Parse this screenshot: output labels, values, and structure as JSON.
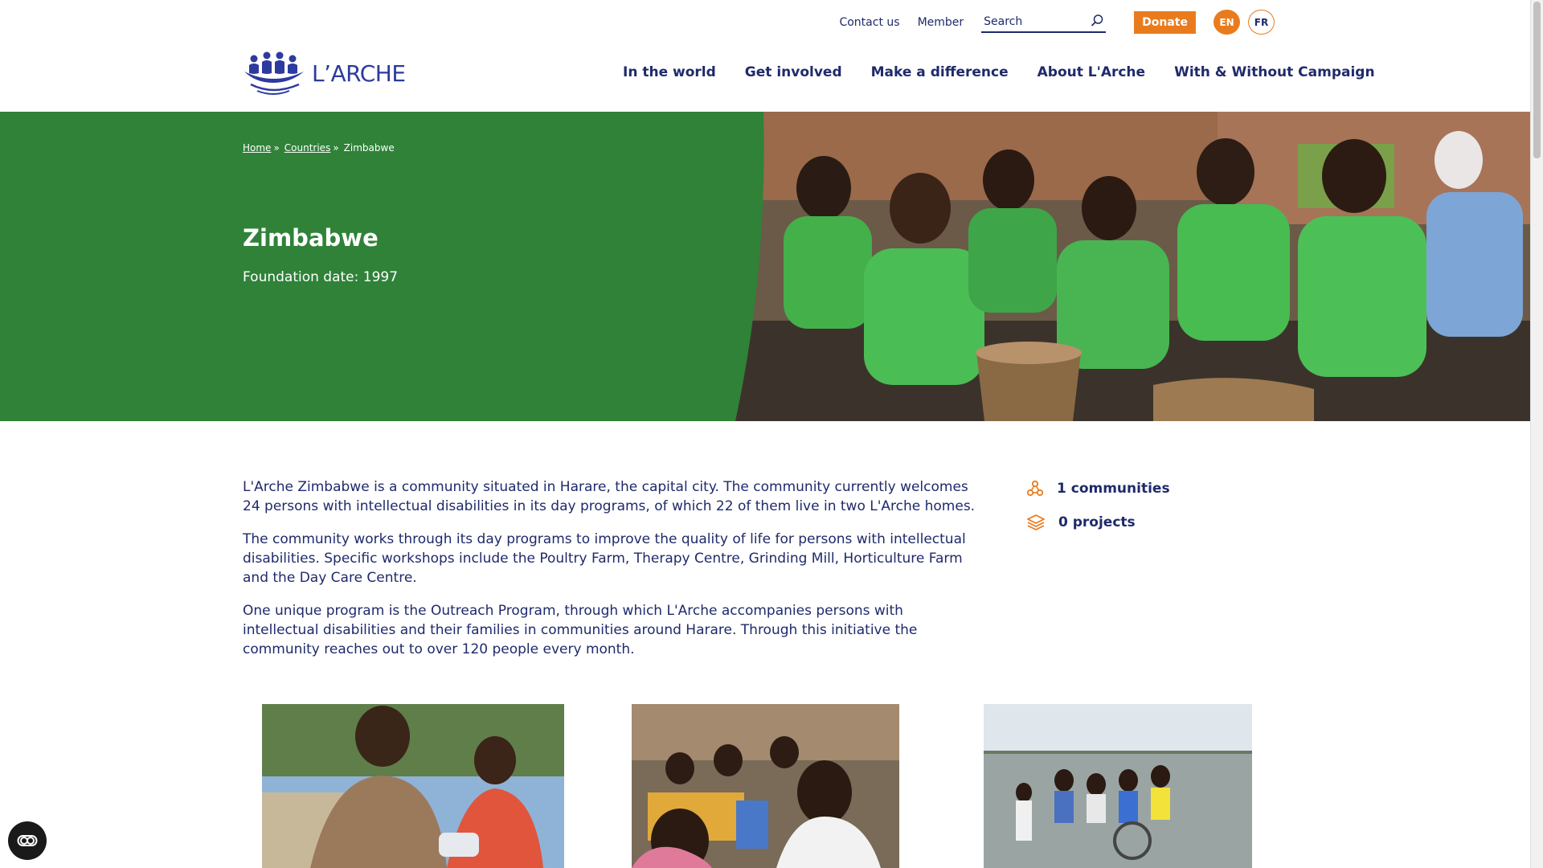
{
  "header": {
    "utility": {
      "contact": "Contact us",
      "member": "Member",
      "search_placeholder": "Search",
      "donate": "Donate",
      "lang_en": "EN",
      "lang_fr": "FR"
    },
    "logo_text": "L’ARCHE",
    "nav": [
      "In the world",
      "Get involved",
      "Make a difference",
      "About L'Arche",
      "With & Without Campaign"
    ]
  },
  "hero": {
    "breadcrumb": {
      "home": "Home",
      "sep1": "»",
      "countries": "Countries",
      "sep2": "»",
      "current": "Zimbabwe"
    },
    "title": "Zimbabwe",
    "subtitle": "Foundation date: 1997"
  },
  "content": {
    "paragraphs": [
      "L'Arche Zimbabwe is a community situated in Harare, the capital city. The community currently welcomes 24 persons with intellectual disabilities in its day programs, of which 22 of them live in two L'Arche homes.",
      "The community works through its day programs to improve the quality of life for persons with intellectual disabilities. Specific workshops include the Poultry Farm, Therapy Centre, Grinding Mill, Horticulture Farm and the Day Care Centre.",
      "One unique program is the Outreach Program, through which  L'Arche accompanies persons with intellectual disabilities and their families in communities around Harare.  Through this initiative the community reaches out to over 120 people every month."
    ]
  },
  "stats": {
    "communities": "1 communities",
    "projects": "0 projects"
  },
  "colors": {
    "brand_navy": "#1f2a6b",
    "accent_orange": "#ea7b1d",
    "hero_green": "#2f8238"
  }
}
